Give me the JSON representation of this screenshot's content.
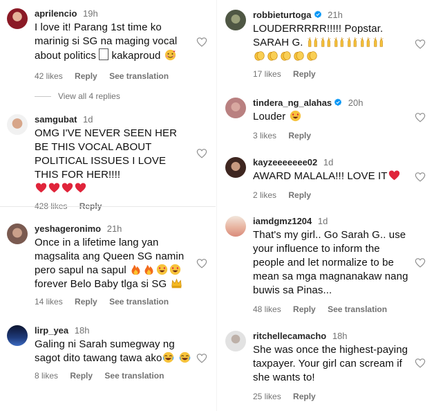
{
  "left_column": {
    "comments": [
      {
        "username": "aprilencio",
        "time": "19h",
        "verified": false,
        "text": "I love it! Parang 1st time ko marinig si SG na maging vocal about politics ✊ kakaproud 🥰",
        "likes": "42 likes",
        "reply": "Reply",
        "see_translation": "See translation",
        "avatar_color": "#7a1020"
      },
      {
        "username": "samgubat",
        "time": "1d",
        "verified": false,
        "text": "OMG I'VE NEVER SEEN HER BE THIS VOCAL ABOUT POLITICAL ISSUES I LOVE THIS FOR HER!!!! ❤️❤️❤️❤️",
        "likes": "428 likes",
        "reply": "Reply",
        "see_translation": "",
        "avatar_color": "#b9876a"
      },
      {
        "username": "yeshageronimo",
        "time": "21h",
        "verified": false,
        "text": "Once in a lifetime lang yan magsalita ang Queen SG namin pero sapul na sapul 🔥🔥😍😍 forever Belo Baby tlga si SG 👑",
        "likes": "14 likes",
        "reply": "Reply",
        "see_translation": "See translation",
        "avatar_color": "#a77a6a"
      },
      {
        "username": "lirp_yea",
        "time": "18h",
        "verified": false,
        "text": "Galing ni Sarah sumegway ng sagot dito tawang tawa ako😂 😂",
        "likes": "8 likes",
        "reply": "Reply",
        "see_translation": "See translation",
        "avatar_color": "#14213d"
      }
    ],
    "view_all": "View all 4 replies"
  },
  "right_column": {
    "comments": [
      {
        "username": "robbieturtoga",
        "time": "21h",
        "verified": true,
        "text": "LOUDERRRRR!!!!! Popstar. SARAH G. 🙌🙌🙌🙌🙌🙌 👏👏👏👏👏",
        "likes": "17 likes",
        "reply": "Reply",
        "see_translation": "",
        "avatar_color": "#6b6b5a"
      },
      {
        "username": "tindera_ng_alahas",
        "time": "20h",
        "verified": true,
        "text": "Louder 😍",
        "likes": "3 likes",
        "reply": "Reply",
        "see_translation": "",
        "avatar_color": "#b88d8d"
      },
      {
        "username": "kayzeeeeeee02",
        "time": "1d",
        "verified": false,
        "text": "AWARD MALALA!!! LOVE IT❤️",
        "likes": "2 likes",
        "reply": "Reply",
        "see_translation": "",
        "avatar_color": "#5a3a30"
      },
      {
        "username": "iamdgmz1204",
        "time": "1d",
        "verified": false,
        "text": "That's my girl.. Go Sarah G.. use your influence to inform the people and let normalize to be mean sa mga magnanakaw nang buwis sa Pinas...",
        "likes": "48 likes",
        "reply": "Reply",
        "see_translation": "See translation",
        "avatar_color": "#d9b9a0"
      },
      {
        "username": "ritchellecamacho",
        "time": "18h",
        "verified": false,
        "text": "She was once the highest-paying taxpayer. Your girl can scream if she wants to!",
        "likes": "25 likes",
        "reply": "Reply",
        "see_translation": "",
        "avatar_color": "#c8c8c8"
      }
    ]
  },
  "colors": {
    "username": "#262626",
    "meta": "#737373",
    "verified_badge": "#0095f6",
    "heart_outline": "#8e8e8e"
  },
  "icons": {
    "like": "heart-outline-icon",
    "verified": "verified-badge-icon"
  }
}
